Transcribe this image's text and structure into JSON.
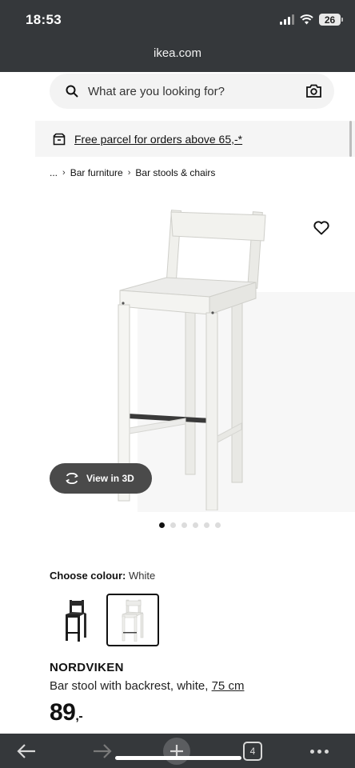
{
  "status_bar": {
    "time": "18:53",
    "battery": "26"
  },
  "browser": {
    "url": "ikea.com",
    "tab_count": "4"
  },
  "search": {
    "placeholder": "What are you looking for?"
  },
  "banner": {
    "text": "Free parcel for orders above 65,-*"
  },
  "breadcrumb": {
    "ellipsis": "...",
    "items": [
      "Bar furniture",
      "Bar stools & chairs"
    ]
  },
  "gallery": {
    "view3d_label": "View in 3D",
    "image_count": 6,
    "active_index": 0
  },
  "colour": {
    "label": "Choose colour:",
    "value": "White",
    "options": [
      "black",
      "white"
    ],
    "selected": "white"
  },
  "product": {
    "name": "NORDVIKEN",
    "description": "Bar stool with backrest, white,",
    "size": "75 cm",
    "price": "89",
    "price_suffix": ",-"
  },
  "icons": {
    "search": "search-icon",
    "camera": "camera-icon",
    "parcel": "parcel-icon",
    "heart": "heart-icon",
    "rotate3d": "rotate-3d-icon",
    "back": "back-arrow-icon",
    "forward": "forward-arrow-icon",
    "plus": "plus-icon",
    "more": "more-icon"
  },
  "colors": {
    "topbar": "#35383b",
    "banner_bg": "#f5f5f5",
    "search_bg": "#f3f3f3",
    "pill": "#4a4a4a"
  }
}
